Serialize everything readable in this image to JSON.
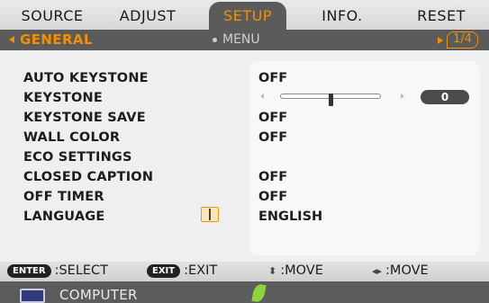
{
  "tabs": [
    {
      "label": "SOURCE",
      "active": false
    },
    {
      "label": "ADJUST",
      "active": false
    },
    {
      "label": "SETUP",
      "active": true
    },
    {
      "label": "INFO.",
      "active": false
    },
    {
      "label": "RESET",
      "active": false
    }
  ],
  "subbar": {
    "section": "GENERAL",
    "menu": "MENU",
    "page": "1/4"
  },
  "settings": [
    {
      "label": "AUTO KEYSTONE",
      "value": "OFF"
    },
    {
      "label": "KEYSTONE",
      "value": "0",
      "slider_position": 0.5
    },
    {
      "label": "KEYSTONE SAVE",
      "value": "OFF"
    },
    {
      "label": "WALL COLOR",
      "value": "OFF"
    },
    {
      "label": "ECO SETTINGS",
      "value": ""
    },
    {
      "label": "CLOSED CAPTION",
      "value": "OFF"
    },
    {
      "label": "OFF TIMER",
      "value": "OFF"
    },
    {
      "label": "LANGUAGE",
      "value": "ENGLISH",
      "icon": "language-icon"
    }
  ],
  "footer": {
    "enter_key": "ENTER",
    "enter_label": ":SELECT",
    "exit_key": "EXIT",
    "exit_label": ":EXIT",
    "move_vertical_label": ":MOVE",
    "move_horizontal_label": ":MOVE"
  },
  "status": {
    "source": "COMPUTER",
    "source_icon": "monitor-icon",
    "eco_icon": "leaf-icon"
  },
  "colors": {
    "accent": "#f29000",
    "dark_bar": "#5b5b5b"
  }
}
